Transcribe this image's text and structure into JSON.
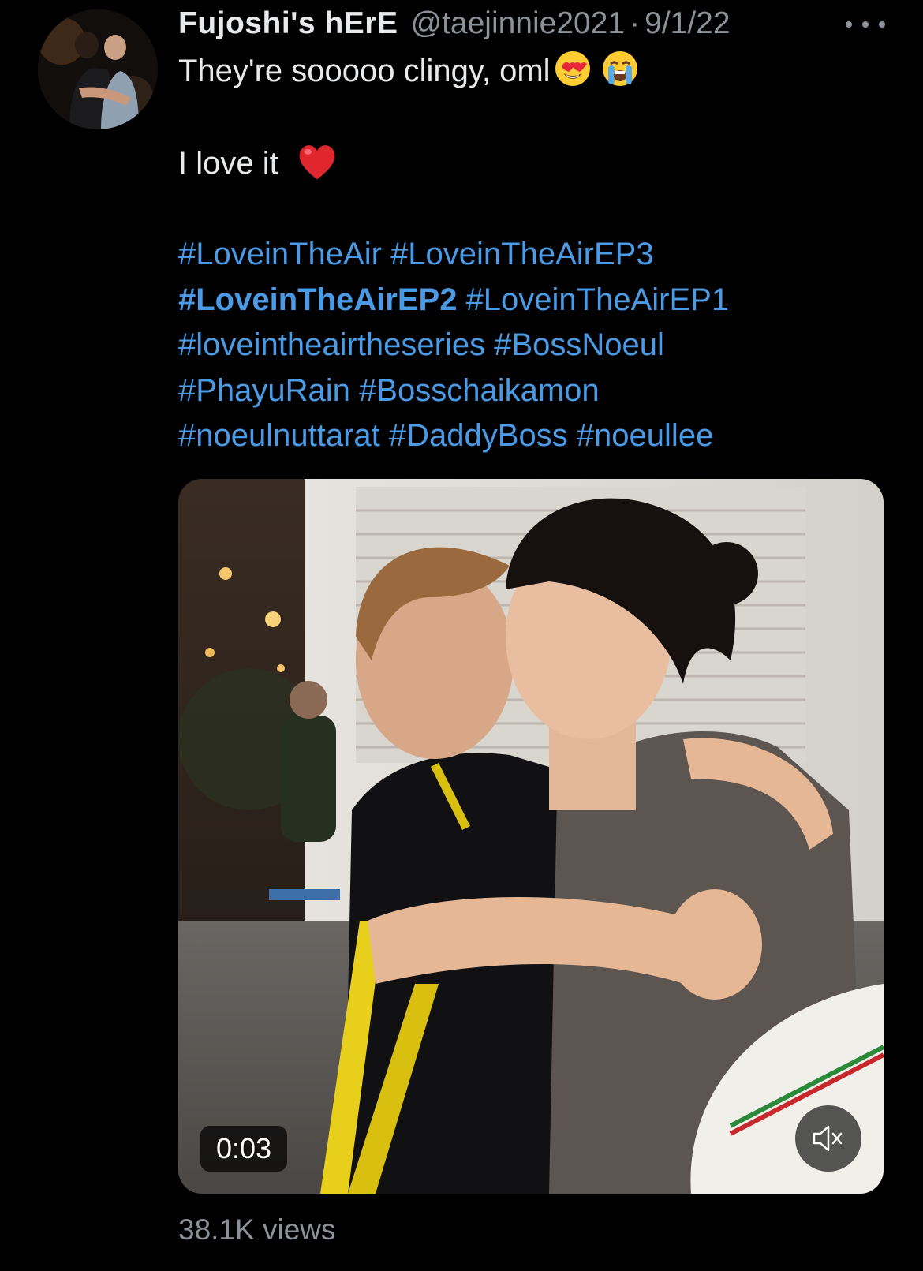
{
  "tweet": {
    "author": {
      "display_name": "Fujoshi's hErE",
      "handle": "@taejinnie2021",
      "separator": "·",
      "date": "9/1/22"
    },
    "text": {
      "line1": "They're sooooo clingy, oml",
      "line1_emojis": [
        "heart-eyes-emoji",
        "loudly-crying-emoji"
      ],
      "line2": "I love it",
      "line2_emoji": "red-heart-emoji"
    },
    "hashtags": [
      {
        "text": "#LoveinTheAir",
        "bold": false
      },
      {
        "text": "#LoveinTheAirEP3",
        "bold": false
      },
      {
        "text": "#LoveinTheAirEP2",
        "bold": true
      },
      {
        "text": "#LoveinTheAirEP1",
        "bold": false
      },
      {
        "text": "#loveintheairtheseries",
        "bold": false
      },
      {
        "text": "#BossNoeul",
        "bold": false
      },
      {
        "text": "#PhayuRain",
        "bold": false
      },
      {
        "text": "#Bosschaikamon",
        "bold": false
      },
      {
        "text": "#noeulnuttarat",
        "bold": false
      },
      {
        "text": "#DaddyBoss",
        "bold": false
      },
      {
        "text": "#noeullee",
        "bold": false
      }
    ],
    "media": {
      "type": "video",
      "duration": "0:03",
      "muted": true
    },
    "views": "38.1K views"
  },
  "colors": {
    "background": "#000000",
    "text": "#e7e9ea",
    "secondary": "#8b9298",
    "hashtag": "#4a9ae6"
  }
}
